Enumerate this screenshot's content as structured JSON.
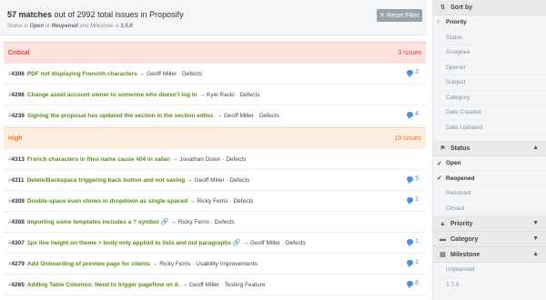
{
  "header": {
    "count": "57 matches",
    "rest": " out of 2992 total issues in Proposify",
    "sub_a": "Status is ",
    "sub_open": "Open",
    "sub_or": " or ",
    "sub_reopened": "Reopened",
    "sub_and": " and Milestone is ",
    "sub_milestone": "1.5.0",
    "reset_label": "Reset Filter"
  },
  "groups": [
    {
      "label": "Critical",
      "count": "3 issues"
    },
    {
      "label": "High",
      "count": "19 issues"
    }
  ],
  "issues": [
    {
      "num": "4306",
      "title": "PDF not displaying Frenchh characters",
      "meta": "→ Geoff Miller · Defects",
      "comments": "2"
    },
    {
      "num": "4296",
      "title": "Change asset account owner to someone who doesn't log in",
      "meta": "→ Kyle Racki · Defects",
      "comments": ""
    },
    {
      "num": "4239",
      "title": "Signing the proposal has updated the section in the section editor.",
      "meta": "→ Geoff Miller · Defects",
      "comments": "4"
    },
    {
      "num": "4313",
      "title": "French characters in files name cause 404 in safari",
      "meta": "→ Jonathan Down · Defects",
      "comments": ""
    },
    {
      "num": "4311",
      "title": "Delete/Backspace triggering back button and not saving",
      "meta": "→ Geoff Miller · Defects",
      "comments": "5"
    },
    {
      "num": "4309",
      "title": "Double-space even shows in dropdown as single-spaced",
      "meta": "→ Ricky Ferris · Defects",
      "comments": "1"
    },
    {
      "num": "4308",
      "title": "Importing some templates includes a ? symbol",
      "meta": "→ Ricky Ferris · Defects",
      "comments": ""
    },
    {
      "num": "4307",
      "title": "1px line height on theme > body only applied to lists and not paragraphs",
      "meta": "→ Geoff Miller · Defects",
      "comments": "1"
    },
    {
      "num": "4279",
      "title": "Add Onboarding of preview page for clients",
      "meta": "→ Ricky Ferris · Usability Improvements",
      "comments": "1"
    },
    {
      "num": "4265",
      "title": "Adding Table Columns: Need to trigger pageflow on it.",
      "meta": "→ Geoff Miller · Testing Feature",
      "comments": "6"
    }
  ],
  "sidebar": {
    "sort_by": "Sort by",
    "sort_items": [
      "Priority",
      "Status",
      "Assignee",
      "Opener",
      "Subject",
      "Category",
      "Date Created",
      "Date Updated"
    ],
    "status": "Status",
    "status_items": [
      "Open",
      "Reopened",
      "Resolved",
      "Closed"
    ],
    "priority": "Priority",
    "category": "Category",
    "milestone": "Milestone",
    "milestone_items": [
      "Unplanned",
      "1.7.9"
    ]
  },
  "colors": {
    "critical": "#d8432e",
    "high": "#e8772e",
    "link": "#5c8a17",
    "comment": "#4a90d9"
  }
}
